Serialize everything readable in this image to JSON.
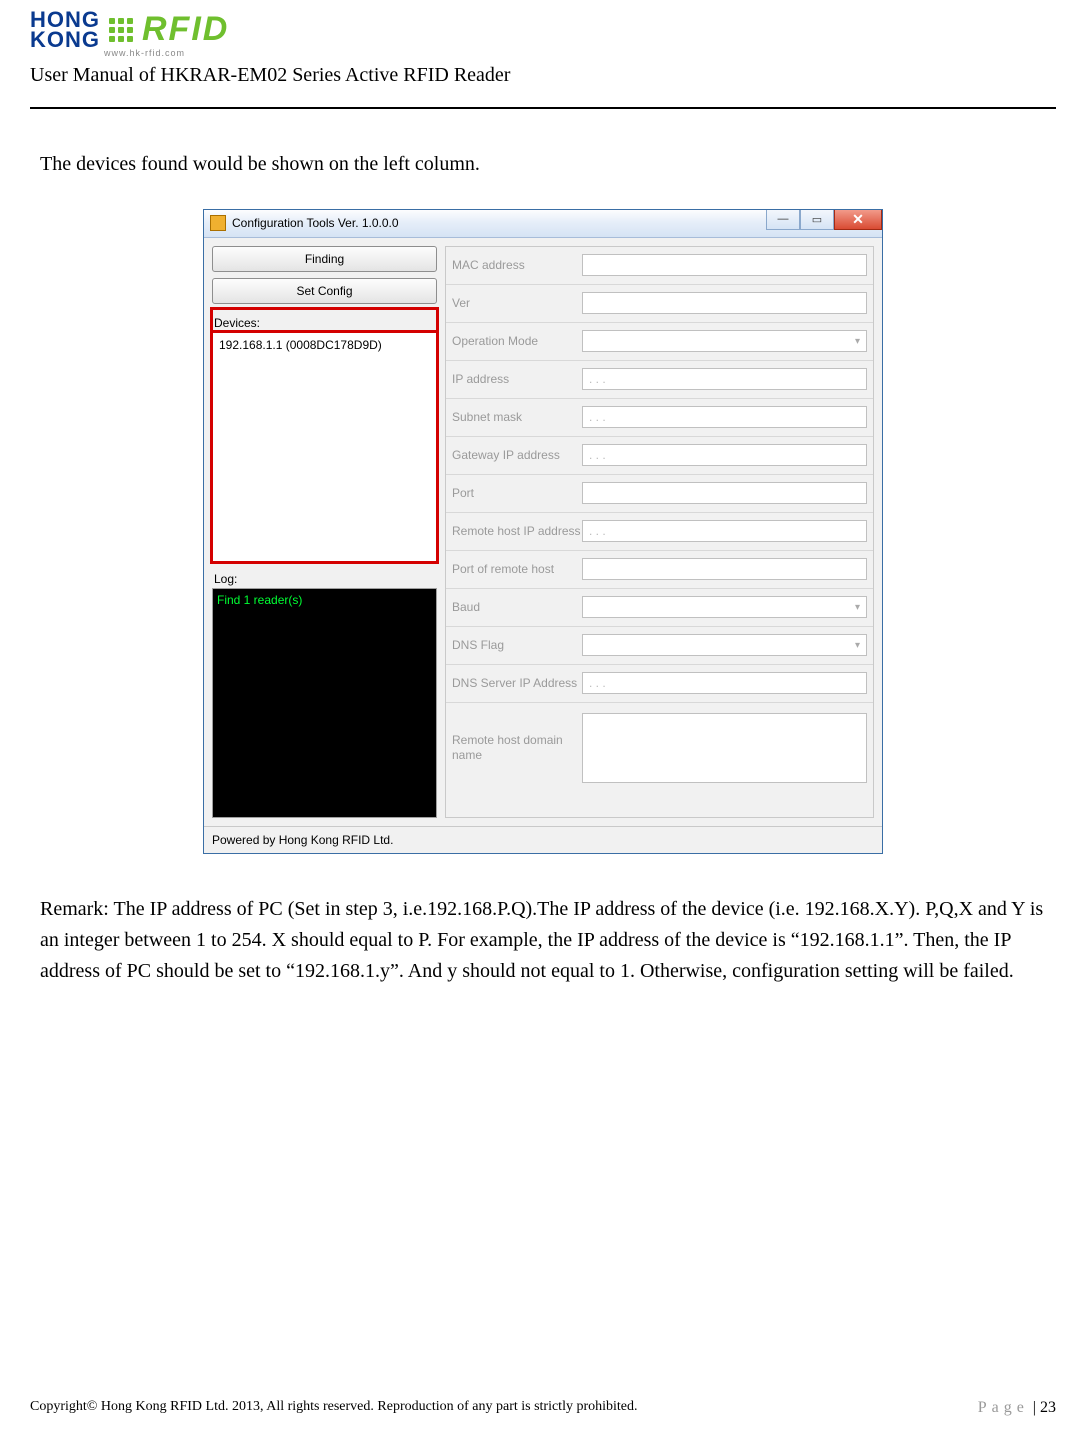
{
  "logo": {
    "hk_line1": "HONG",
    "hk_line2": "KONG",
    "rfid": "RFID",
    "url": "www.hk-rfid.com"
  },
  "doc_title": "User Manual of HKRAR-EM02 Series Active RFID Reader",
  "intro_text": "The devices found would be shown on the left column.",
  "window": {
    "title": "Configuration Tools Ver. 1.0.0.0",
    "buttons": {
      "finding": "Finding",
      "set_config": "Set Config"
    },
    "devices_label": "Devices:",
    "device_item": "192.168.1.1 (0008DC178D9D)",
    "log_label": "Log:",
    "log_line": "Find 1 reader(s)",
    "rows": [
      {
        "label": "MAC address",
        "value": "",
        "type": "text"
      },
      {
        "label": "Ver",
        "value": "",
        "type": "text"
      },
      {
        "label": "Operation Mode",
        "value": "",
        "type": "dropdown"
      },
      {
        "label": "IP address",
        "value": ".   .   .",
        "type": "text"
      },
      {
        "label": "Subnet mask",
        "value": ".   .   .",
        "type": "text"
      },
      {
        "label": "Gateway IP address",
        "value": ".   .   .",
        "type": "text"
      },
      {
        "label": "Port",
        "value": "",
        "type": "text"
      },
      {
        "label": "Remote host IP address",
        "value": ".   .   .",
        "type": "text"
      },
      {
        "label": "Port of remote host",
        "value": "",
        "type": "text"
      },
      {
        "label": "Baud",
        "value": "",
        "type": "dropdown"
      },
      {
        "label": "DNS Flag",
        "value": "",
        "type": "dropdown"
      },
      {
        "label": "DNS Server IP Address",
        "value": ".   .   .",
        "type": "text"
      },
      {
        "label": "Remote host domain name",
        "value": "",
        "type": "textarea"
      }
    ],
    "statusbar": "Powered by Hong Kong RFID Ltd."
  },
  "remark": "Remark: The IP address of PC (Set in step 3, i.e.192.168.P.Q).The IP address of the device (i.e. 192.168.X.Y). P,Q,X and Y is an integer between 1 to 254. X should equal to P. For example, the IP address of the device is “192.168.1.1”. Then, the IP address of PC should be set to “192.168.1.y”. And y should not equal to 1. Otherwise, configuration setting will be failed.",
  "footer": {
    "copyright": "Copyright© Hong Kong RFID Ltd. 2013, All rights reserved. Reproduction of any part is strictly prohibited.",
    "page_label": "Page",
    "page_sep": " | ",
    "page_num": "23"
  }
}
